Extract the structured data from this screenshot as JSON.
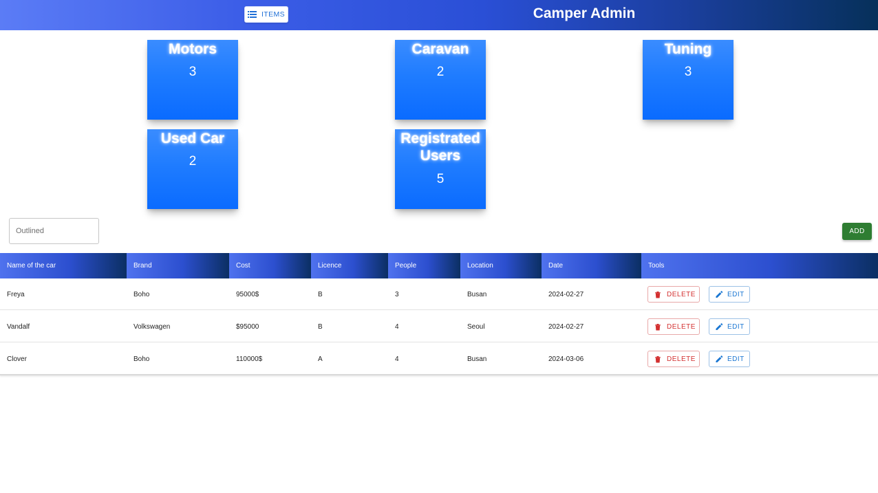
{
  "header": {
    "items_button_label": "ITEMS",
    "title": "Camper Admin"
  },
  "cards": [
    {
      "title": "Motors",
      "count": "3"
    },
    {
      "title": "Caravan",
      "count": "2"
    },
    {
      "title": "Tuning",
      "count": "3"
    },
    {
      "title": "Used Car",
      "count": "2"
    },
    {
      "title_line1": "Registrated",
      "title_line2": "Users",
      "count": "5"
    }
  ],
  "toolbar": {
    "search_placeholder": "Outlined",
    "add_label": "ADD"
  },
  "table": {
    "columns": [
      "Name of the car",
      "Brand",
      "Cost",
      "Licence",
      "People",
      "Location",
      "Date",
      "Tools"
    ],
    "rows": [
      [
        "Freya",
        "Boho",
        "95000$",
        "B",
        "3",
        "Busan",
        "2024-02-27"
      ],
      [
        "Vandalf",
        "Volkswagen",
        "$95000",
        "B",
        "4",
        "Seoul",
        "2024-02-27"
      ],
      [
        "Clover",
        "Boho",
        "110000$",
        "A",
        "4",
        "Busan",
        "2024-03-06"
      ]
    ],
    "delete_label": "DELETE",
    "edit_label": "EDIT"
  },
  "colors": {
    "header_gradient_start": "#5b7cf6",
    "header_gradient_end": "#06305a",
    "card_blue": "#1f7cff",
    "add_green": "#2e7d32",
    "delete_red": "#d32f2f",
    "edit_blue": "#1976d2"
  },
  "icons": {
    "items_button": "list-icon",
    "delete_button": "trash-icon",
    "edit_button": "pencil-icon"
  }
}
